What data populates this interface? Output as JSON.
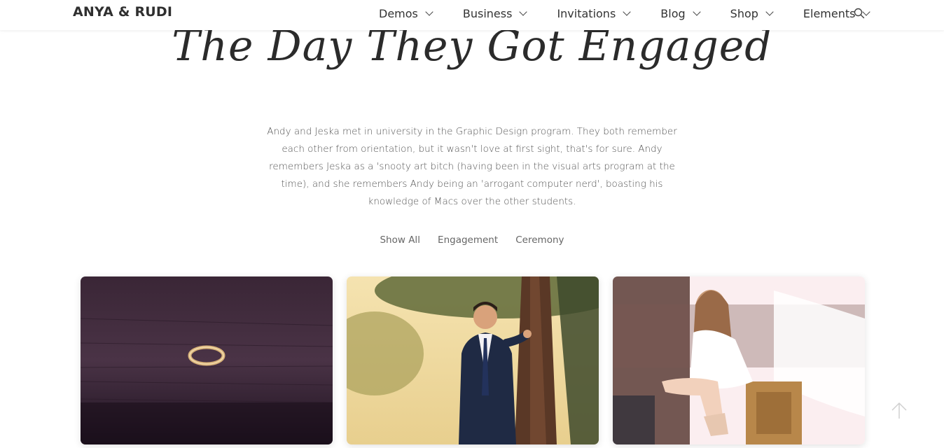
{
  "header": {
    "logo": "ANYA & RUDI",
    "nav": [
      {
        "label": "Demos",
        "name": "demos"
      },
      {
        "label": "Business",
        "name": "business"
      },
      {
        "label": "Invitations",
        "name": "invitations"
      },
      {
        "label": "Blog",
        "name": "blog"
      },
      {
        "label": "Shop",
        "name": "shop"
      },
      {
        "label": "Elements",
        "name": "elements"
      }
    ],
    "search_icon": "search-icon"
  },
  "hero": {
    "title": "The Day They Got Engaged"
  },
  "description": "Andy and Jeska met in university in the Graphic Design program. They both remember each other from orientation, but it wasn't love at first sight, that's for sure. Andy remembers Jeska as a 'snooty art bitch (having been in the visual arts program at the time), and she remembers Andy being an 'arrogant computer nerd', boasting his knowledge of Macs over the other students.",
  "filters": [
    "Show All",
    "Engagement",
    "Ceremony"
  ],
  "gallery": [
    {
      "name": "ring-photo"
    },
    {
      "name": "groom-tree-photo"
    },
    {
      "name": "bride-shoe-photo"
    }
  ],
  "colors": {
    "text": "#333333",
    "muted": "#666666",
    "background": "#ffffff"
  },
  "back_to_top_icon": "arrow-up-icon"
}
